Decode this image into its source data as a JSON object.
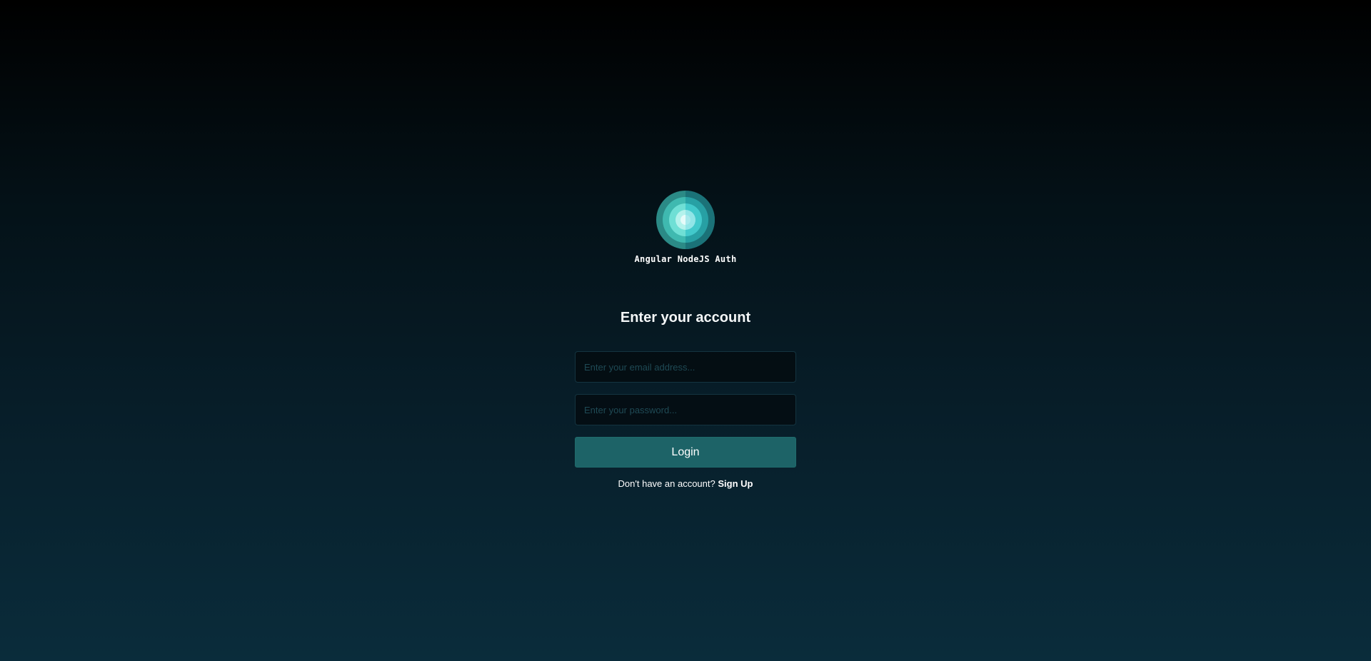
{
  "app": {
    "name": "Angular NodeJS Auth",
    "logo_icon": "concentric-circles-logo-icon"
  },
  "login": {
    "heading": "Enter your account",
    "email_placeholder": "Enter your email address...",
    "password_placeholder": "Enter your password...",
    "email_value": "",
    "password_value": "",
    "submit_label": "Login",
    "signup_prompt": "Don't have an account?",
    "signup_link": "Sign Up"
  },
  "colors": {
    "accent": "#1d6367",
    "logo_outer": "#2a8a86",
    "logo_mid": "#3fc6bd",
    "logo_inner": "#a8f0ea",
    "background_top": "#000000",
    "background_bottom": "#0a2c3b"
  }
}
